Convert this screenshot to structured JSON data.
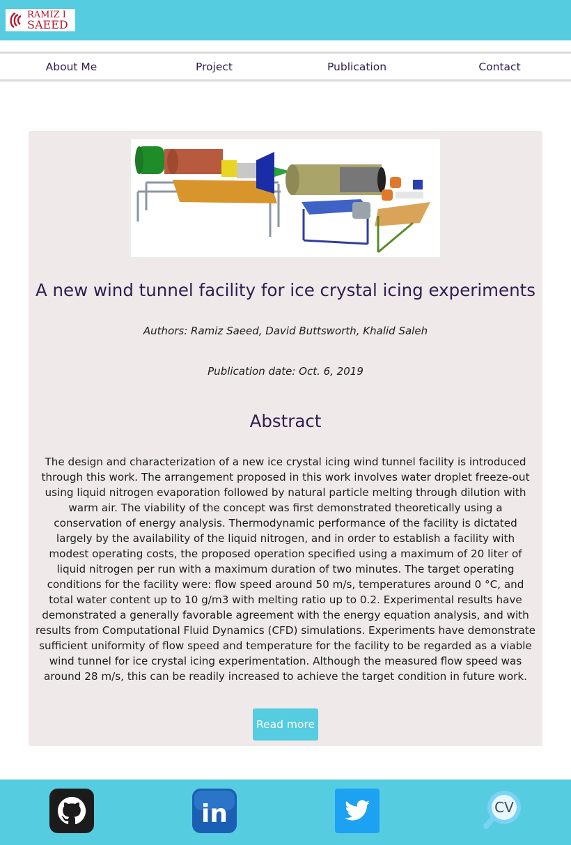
{
  "brand": {
    "name_line1": "RAMIZ I",
    "name_line2": "SAEED",
    "color": "#b5162b",
    "header_color": "#55cce0"
  },
  "nav": {
    "items": [
      {
        "label": "About Me"
      },
      {
        "label": "Project"
      },
      {
        "label": "Publication"
      },
      {
        "label": "Contact"
      }
    ]
  },
  "publication": {
    "title": "A new wind tunnel facility for ice crystal icing experiments",
    "authors": "Authors: Ramiz Saeed, David Buttsworth, Khalid Saleh",
    "date": "Publication date: Oct. 6, 2019",
    "abstract_heading": "Abstract",
    "abstract": "The design and characterization of a new ice crystal icing wind tunnel facility is introduced through this work. The arrangement proposed in this work involves water droplet freeze-out using liquid nitrogen evaporation followed by natural particle melting through dilution with warm air. The viability of the concept was first demonstrated theoretically using a conservation of energy analysis. Thermodynamic performance of the facility is dictated largely by the availability of the liquid nitrogen, and in order to establish a facility with modest operating costs, the proposed operation specified using a maximum of 20 liter of liquid nitrogen per run with a maximum duration of two minutes. The target operating conditions for the facility were: flow speed around 50 m/s, temperatures around 0 °C, and total water content up to 10 g/m3 with melting ratio up to 0.2. Experimental results have demonstrated a generally favorable agreement with the energy equation analysis, and with results from Computational Fluid Dynamics (CFD) simulations. Experiments have demonstrate sufficient uniformity of flow speed and temperature for the facility to be regarded as a viable wind tunnel for ice crystal icing experimentation. Although the measured flow speed was around 28 m/s, this can be readily increased to achieve the target condition in future work.",
    "read_more_label": "Read more"
  },
  "footer": {
    "icons": [
      "github-icon",
      "linkedin-icon",
      "twitter-icon",
      "cv-icon"
    ],
    "cv_label": "CV",
    "linkedin_label": "in"
  }
}
